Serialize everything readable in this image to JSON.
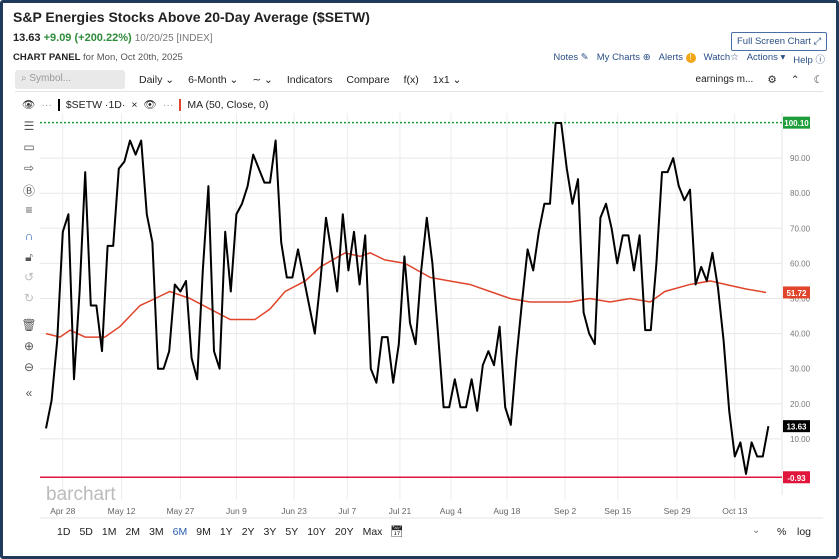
{
  "header": {
    "title": "S&P Energies Stocks Above 20-Day Average ($SETW)",
    "last": "13.63",
    "change": "+9.09 (+200.22%)",
    "date": "10/20/25 [INDEX]",
    "panel_label": "CHART PANEL",
    "panel_date": "for Mon, Oct 20th, 2025",
    "fullscreen": "Full Screen Chart"
  },
  "links": {
    "notes": "Notes",
    "my_charts": "My Charts",
    "alerts": "Alerts",
    "watch": "Watch",
    "actions": "Actions",
    "help": "Help"
  },
  "toolbar": {
    "symbol_placeholder": "Symbol...",
    "interval": "Daily",
    "period": "6-Month",
    "indicators": "Indicators",
    "compare": "Compare",
    "fx": "f(x)",
    "layout": "1x1",
    "earnings": "earnings m..."
  },
  "legend": {
    "symbol": "$SETW",
    "interval": "1D",
    "ma": "MA (50, Close, 0)"
  },
  "watermark": "barchart",
  "ranges": [
    "1D",
    "5D",
    "1M",
    "2M",
    "3M",
    "6M",
    "9M",
    "1Y",
    "2Y",
    "3Y",
    "5Y",
    "10Y",
    "20Y",
    "Max"
  ],
  "active_range": "6M",
  "bottom_right": {
    "percent": "%",
    "log": "log"
  },
  "colors": {
    "price": "#000000",
    "ma": "#e0452c",
    "high": "#1e9e3a",
    "low": "#e0153c",
    "up": "#2e8b3a"
  },
  "chart_data": {
    "type": "line",
    "ylim": [
      -3,
      103
    ],
    "y_ticks": [
      10,
      20,
      30,
      40,
      50,
      60,
      70,
      80,
      90
    ],
    "y_tick_labels": [
      "10.00",
      "20.00",
      "30.00",
      "40.00",
      "50.00",
      "60.00",
      "70.00",
      "80.00",
      "90.00"
    ],
    "x_ticks": [
      {
        "label": "Apr 28",
        "index": 3
      },
      {
        "label": "May 12",
        "index": 13.5
      },
      {
        "label": "May 27",
        "index": 24
      },
      {
        "label": "Jun 9",
        "index": 34
      },
      {
        "label": "Jun 23",
        "index": 44.3
      },
      {
        "label": "Jul 7",
        "index": 53.8
      },
      {
        "label": "Jul 21",
        "index": 63.2
      },
      {
        "label": "Aug 4",
        "index": 72.3
      },
      {
        "label": "Aug 18",
        "index": 82.3
      },
      {
        "label": "Sep 2",
        "index": 92.7
      },
      {
        "label": "Sep 15",
        "index": 102.1
      },
      {
        "label": "Sep 29",
        "index": 112.7
      },
      {
        "label": "Oct 13",
        "index": 123
      }
    ],
    "grid": true,
    "series": [
      {
        "name": "$SETW",
        "values": [
          13,
          21,
          38,
          69,
          74,
          27,
          52,
          86,
          48,
          48,
          35,
          65,
          65,
          87,
          89,
          95,
          91,
          95,
          74,
          66,
          30,
          30,
          35,
          54,
          52,
          55,
          33,
          27,
          58,
          82,
          35,
          30,
          69,
          52,
          74,
          77,
          82,
          91,
          87,
          83,
          83,
          95,
          66,
          56,
          56,
          64,
          56,
          48,
          40,
          55,
          73,
          63,
          52,
          74,
          58,
          69,
          54,
          68,
          30,
          26,
          39,
          39,
          26,
          37,
          62,
          43,
          37,
          58,
          73,
          60,
          40,
          19,
          19,
          27,
          19,
          19,
          27,
          18,
          31,
          35,
          31,
          42,
          19,
          14,
          33,
          49,
          64,
          58,
          69,
          77,
          77,
          100,
          100,
          87,
          77,
          84,
          46,
          40,
          37,
          73,
          77,
          70,
          60,
          68,
          68,
          58,
          68,
          41,
          41,
          60,
          86,
          86,
          90,
          82,
          78,
          81,
          54,
          59,
          55,
          63,
          53,
          38,
          18,
          5,
          9,
          0,
          9,
          5,
          5,
          13.63
        ]
      },
      {
        "name": "MA (50, Close, 0)",
        "points": [
          [
            0,
            40
          ],
          [
            2.5,
            39
          ],
          [
            4.3,
            41
          ],
          [
            7,
            39
          ],
          [
            10.5,
            39
          ],
          [
            13.2,
            42
          ],
          [
            16.8,
            48
          ],
          [
            19.5,
            50
          ],
          [
            22.1,
            52
          ],
          [
            25.7,
            50
          ],
          [
            29.3,
            47
          ],
          [
            32.9,
            44
          ],
          [
            37.3,
            44
          ],
          [
            40,
            47
          ],
          [
            42.7,
            52
          ],
          [
            46.3,
            55
          ],
          [
            49,
            59
          ],
          [
            53.4,
            63
          ],
          [
            56.1,
            62
          ],
          [
            57.9,
            63
          ],
          [
            60.5,
            61
          ],
          [
            64.1,
            60
          ],
          [
            68.6,
            56
          ],
          [
            72.1,
            55
          ],
          [
            75.7,
            54
          ],
          [
            79.3,
            52
          ],
          [
            82.9,
            50
          ],
          [
            86.4,
            49
          ],
          [
            90,
            49
          ],
          [
            93.6,
            49
          ],
          [
            97.1,
            50
          ],
          [
            100.7,
            49
          ],
          [
            104.3,
            50
          ],
          [
            107.9,
            49
          ],
          [
            110.5,
            52
          ],
          [
            115,
            54
          ],
          [
            118.6,
            55
          ],
          [
            121.4,
            54
          ],
          [
            125,
            52.7
          ],
          [
            128.6,
            51.72
          ]
        ]
      }
    ],
    "high_line": {
      "value": 100.1,
      "label": "100.10"
    },
    "low_line": {
      "value": -0.93,
      "label": "-0.93"
    },
    "last_price_label": "13.63",
    "ma_last_label": "51.72"
  }
}
